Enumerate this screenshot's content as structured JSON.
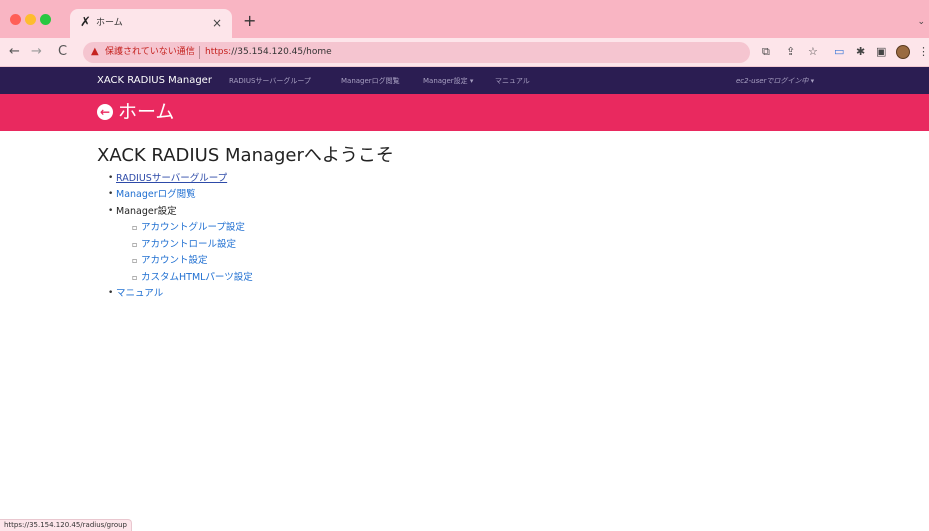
{
  "browser": {
    "tab": {
      "title": "ホーム",
      "favicon_icon": "xack-logo-icon"
    },
    "newtab_icon": "plus-icon",
    "address": {
      "warning": "保護されていない通信",
      "url_scheme": "https:",
      "url_rest": "//35.154.120.45/home"
    },
    "status_url": "https://35.154.120.45/radius/group"
  },
  "colors": {
    "tabstrip": "#f9b5c3",
    "navbar": "#2b1d52",
    "band": "#e9295f",
    "link": "#1f6fd1"
  },
  "navbar": {
    "brand": "XACK RADIUS Manager",
    "links": [
      "RADIUSサーバーグループ",
      "Managerログ閲覧",
      "Manager設定 ▾",
      "マニュアル"
    ],
    "user": "ec2-userでログイン中 ▾"
  },
  "header": {
    "title": "ホーム",
    "back_icon": "circle-arrow-left-icon"
  },
  "main": {
    "welcome": "XACK RADIUS Managerへようこそ",
    "menu": [
      "RADIUSサーバーグループ",
      "Managerログ閲覧",
      "Manager設定",
      "アカウントグループ設定",
      "アカウントロール設定",
      "アカウント設定",
      "カスタムHTMLパーツ設定",
      "マニュアル"
    ]
  }
}
